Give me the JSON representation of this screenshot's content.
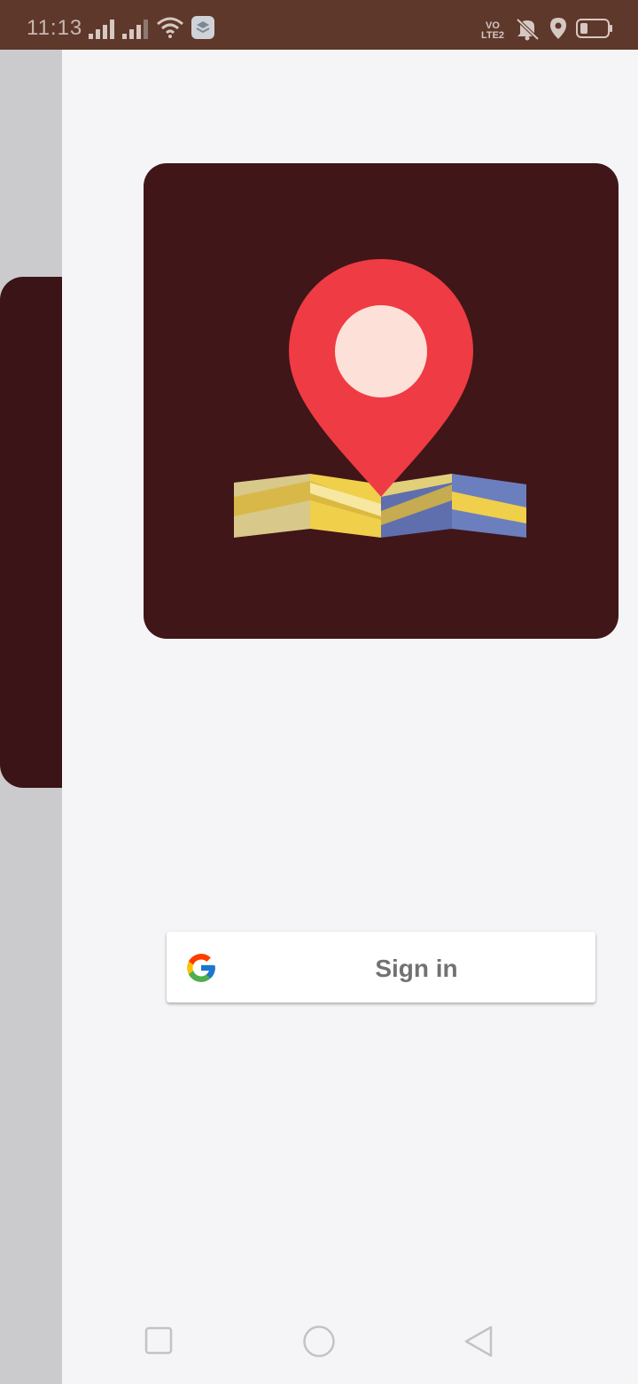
{
  "status_bar": {
    "time": "11:13",
    "network_label": "VO\nLTE2",
    "icons": [
      "signal-icon",
      "signal-icon-2",
      "wifi-icon",
      "layers-icon",
      "volte-icon",
      "bell-off-icon",
      "location-icon",
      "battery-icon"
    ]
  },
  "logo": {
    "icons": [
      "map-pin-icon",
      "folded-map-icon"
    ],
    "colors": {
      "card_background": "#401618",
      "pin": "#ef3b43",
      "pin_center": "#fde0d8",
      "map_yellow": "#f0cf4a",
      "map_blue": "#6b7fbf"
    }
  },
  "signin": {
    "label": "Sign in",
    "icon": "google-g-icon"
  },
  "nav_bar": {
    "icons": [
      "recents-square-icon",
      "home-circle-icon",
      "back-triangle-icon"
    ]
  },
  "colors": {
    "status_bar": "#5e382b",
    "background": "#f5f5f7",
    "left_panel": "#cbcbcd",
    "left_card": "#3a1416"
  }
}
